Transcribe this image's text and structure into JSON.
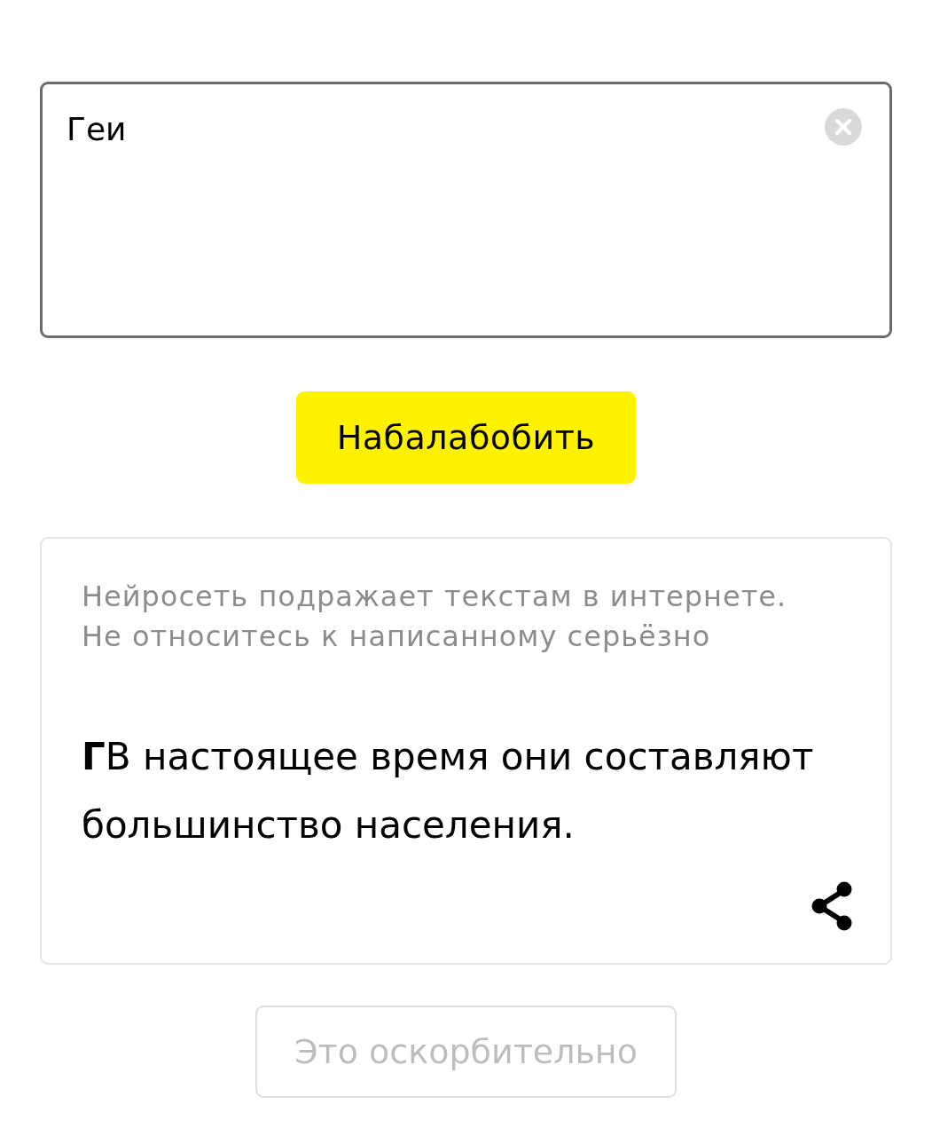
{
  "input": {
    "value": "Геи"
  },
  "generate_button": {
    "label": "Набалабобить"
  },
  "result_card": {
    "disclaimer": "Нейросеть подражает текстам в интернете. Не относитесь к написанному серьёзно",
    "text": "**Г**В настоящее время они составляют большинство населения."
  },
  "report_button": {
    "label": "Это оскорбительно",
    "disabled": true
  }
}
